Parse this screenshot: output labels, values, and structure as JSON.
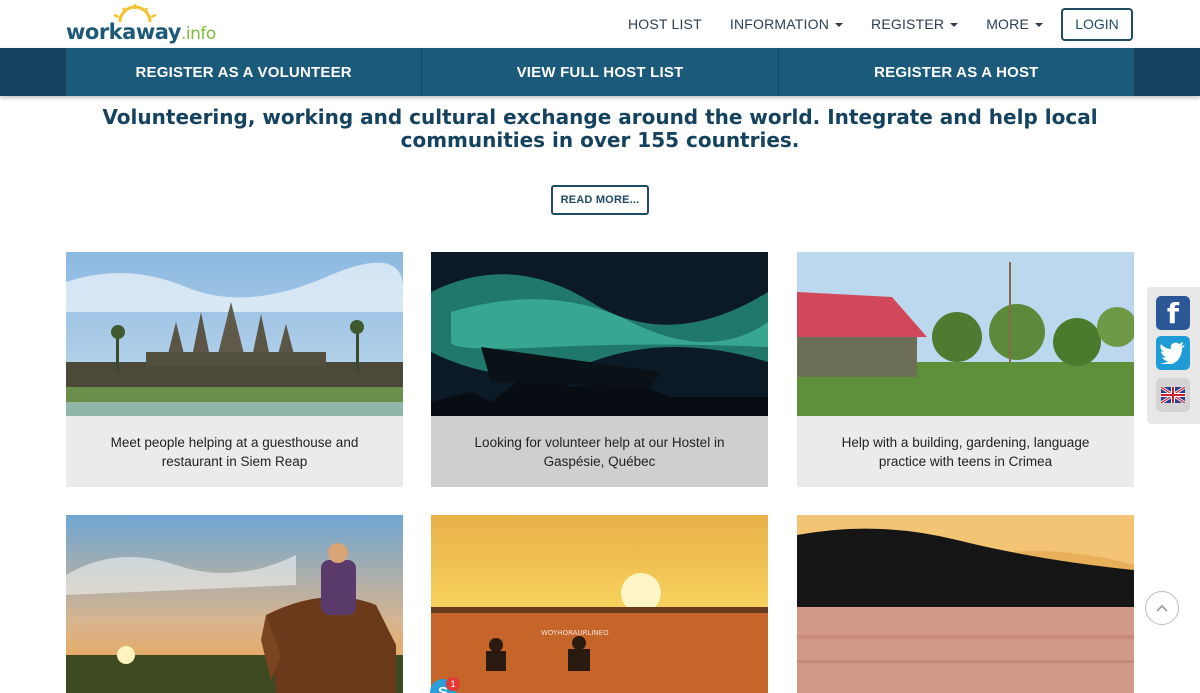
{
  "header": {
    "logo_text": "workaway",
    "logo_suffix": ".info",
    "nav": [
      {
        "label": "HOST LIST",
        "dropdown": false
      },
      {
        "label": "INFORMATION",
        "dropdown": true
      },
      {
        "label": "REGISTER",
        "dropdown": true
      },
      {
        "label": "MORE",
        "dropdown": true
      }
    ],
    "login_label": "LOGIN"
  },
  "actions": [
    {
      "label": "REGISTER AS A VOLUNTEER"
    },
    {
      "label": "VIEW FULL HOST LIST"
    },
    {
      "label": "REGISTER AS A HOST"
    }
  ],
  "hero": {
    "headline": "Volunteering, working and cultural exchange around the world. Integrate and help local communities in over 155 countries.",
    "read_more_label": "READ MORE..."
  },
  "cards": [
    {
      "caption": "Meet people helping at a guesthouse and restaurant in Siem Reap",
      "image": "angkor-wat-temple"
    },
    {
      "caption": "Looking for volunteer help at our Hostel in Gaspésie, Québec",
      "image": "northern-lights-boat"
    },
    {
      "caption": "Help with a building, gardening, language practice with teens in Crimea",
      "image": "red-roof-garden"
    },
    {
      "caption": "",
      "image": "horse-rider-sunset"
    },
    {
      "caption": "",
      "image": "sunset-field-people"
    },
    {
      "caption": "",
      "image": "lake-sunset-hills"
    }
  ],
  "overlay_card_text": "WOYHORAURLINEO",
  "social": {
    "facebook_glyph": "f",
    "twitter_icon": "twitter-icon",
    "language_icon": "uk-flag-icon"
  },
  "chat": {
    "skype_glyph": "S",
    "unread_count": "1"
  },
  "colors": {
    "primary": "#1c5a7c",
    "dark": "#15425e",
    "accent_green": "#7cbd3c",
    "logo_sun": "#f4c430"
  }
}
